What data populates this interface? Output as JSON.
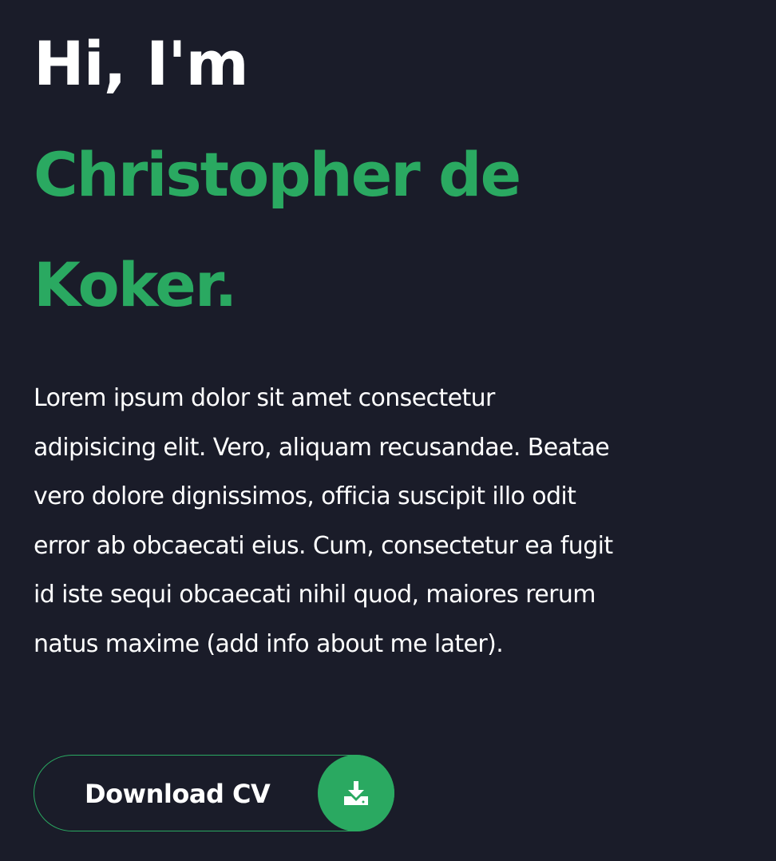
{
  "hero": {
    "greeting": "Hi, I'm",
    "name": "Christopher de Koker.",
    "bio": "Lorem ipsum dolor sit amet consectetur adipisicing elit. Vero, aliquam recusandae. Beatae vero dolore dignissimos, officia suscipit illo odit error ab obcaecati eius. Cum, consectetur ea fugit id iste sequi obcaecati nihil quod, maiores rerum natus maxime (add info about me later)."
  },
  "cv_button": {
    "label": "Download CV",
    "icon": "download-icon"
  },
  "colors": {
    "background": "#1a1c29",
    "accent": "#2aa961",
    "text": "#ffffff"
  }
}
